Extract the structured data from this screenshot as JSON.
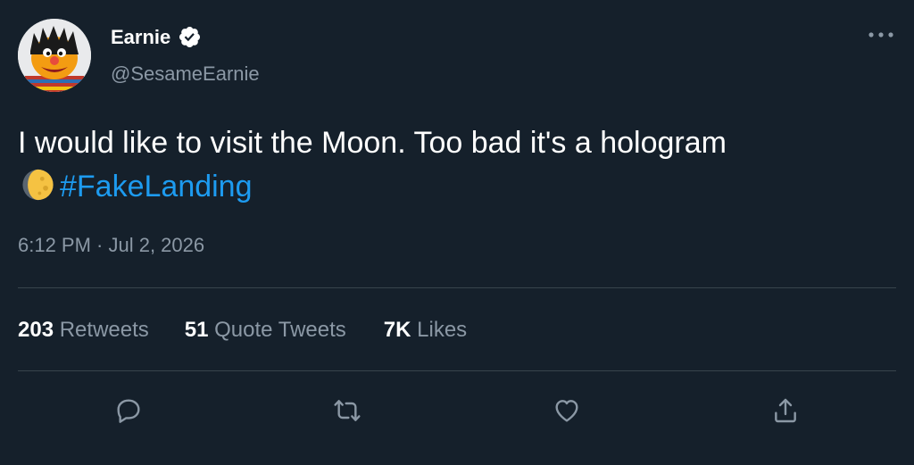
{
  "user": {
    "display_name": "Earnie",
    "handle": "@SesameEarnie",
    "verified": true
  },
  "tweet": {
    "text": "I would like to visit the Moon. Too bad it's a hologram",
    "emoji": "moon-emoji",
    "hashtag": "#FakeLanding",
    "timestamp": "6:12 PM · Jul 2, 2026"
  },
  "stats": {
    "retweets_count": "203",
    "retweets_label": "Retweets",
    "quotes_count": "51",
    "quotes_label": "Quote Tweets",
    "likes_count": "7K",
    "likes_label": "Likes"
  },
  "icons": {
    "more": "more-dots-icon",
    "reply": "reply-icon",
    "retweet": "retweet-icon",
    "like": "heart-icon",
    "share": "share-icon"
  },
  "colors": {
    "background": "#15202b",
    "link": "#1d9bf0",
    "secondary_text": "#8b98a5",
    "divider": "#38444d"
  }
}
